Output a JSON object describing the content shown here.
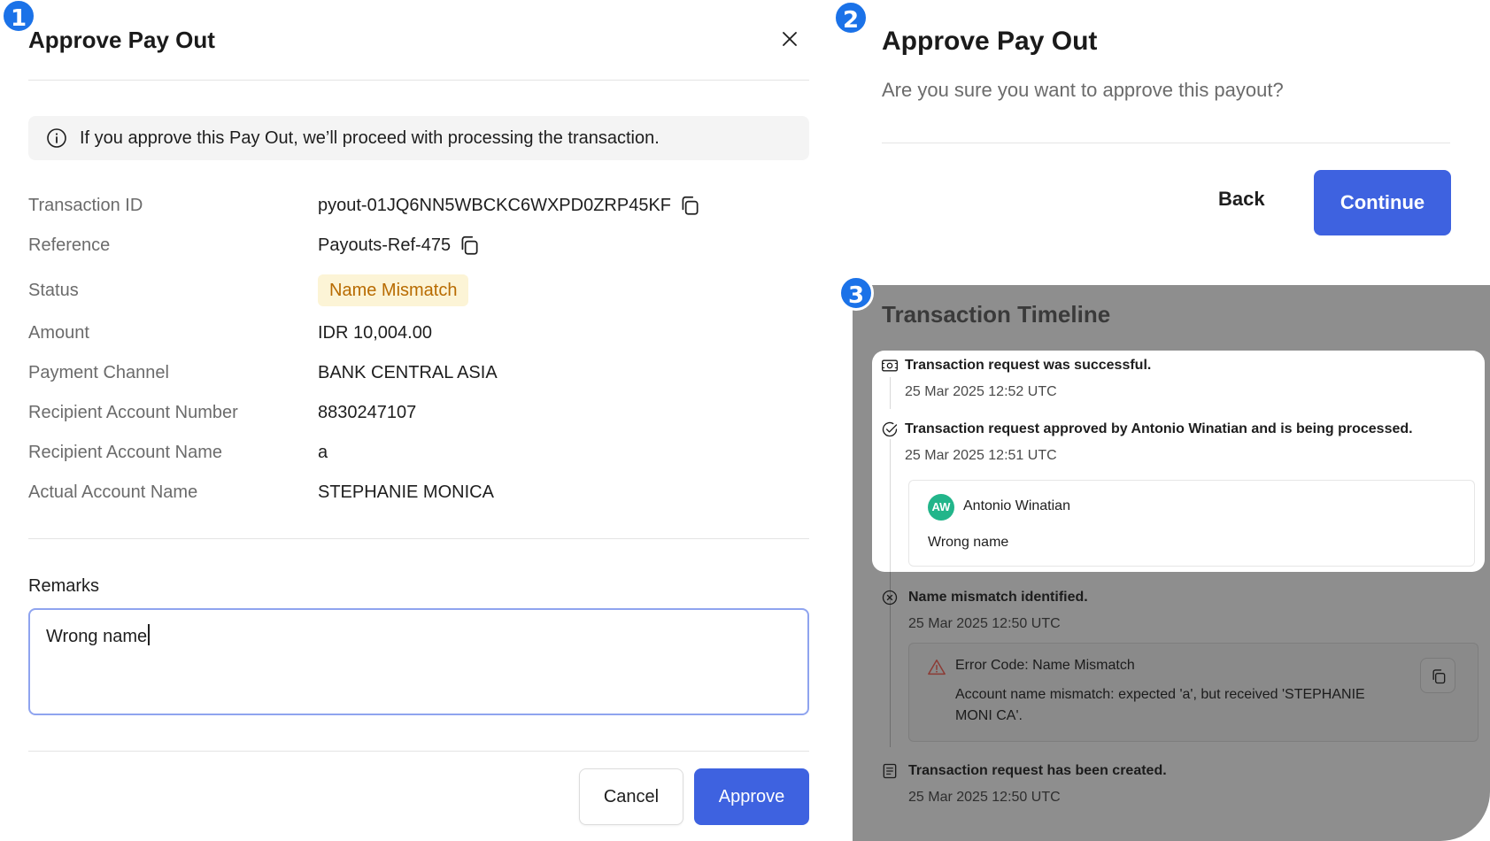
{
  "badges": [
    "1",
    "2",
    "3"
  ],
  "panel1": {
    "title": "Approve Pay Out",
    "info_text": "If you approve this Pay Out, we’ll proceed with processing the transaction.",
    "details": {
      "transaction_id": {
        "label": "Transaction ID",
        "value": "pyout-01JQ6NN5WBCKC6WXPD0ZRP45KF"
      },
      "reference": {
        "label": "Reference",
        "value": "Payouts-Ref-475"
      },
      "status": {
        "label": "Status",
        "value": "Name Mismatch"
      },
      "amount": {
        "label": "Amount",
        "value": "IDR 10,004.00"
      },
      "payment_channel": {
        "label": "Payment Channel",
        "value": "BANK CENTRAL ASIA"
      },
      "recipient_account_number": {
        "label": "Recipient Account Number",
        "value": "8830247107"
      },
      "recipient_account_name": {
        "label": "Recipient Account Name",
        "value": "a"
      },
      "actual_account_name": {
        "label": "Actual Account Name",
        "value": "STEPHANIE MONICA"
      }
    },
    "remarks_label": "Remarks",
    "remarks_value": "Wrong name",
    "cancel_label": "Cancel",
    "approve_label": "Approve"
  },
  "panel2": {
    "title": "Approve Pay Out",
    "subtitle": "Are you sure you want to approve this payout?",
    "back_label": "Back",
    "continue_label": "Continue"
  },
  "panel3": {
    "title": "Transaction Timeline",
    "events": [
      {
        "title": "Transaction request was successful.",
        "time": "25 Mar 2025 12:52 UTC",
        "icon": "money-icon"
      },
      {
        "title": "Transaction request approved by Antonio Winatian and is being processed.",
        "time": "25 Mar 2025 12:51 UTC",
        "icon": "check-circle-icon"
      },
      {
        "title": "Name mismatch identified.",
        "time": "25 Mar 2025 12:50 UTC",
        "icon": "x-circle-icon"
      },
      {
        "title": "Transaction request has been created.",
        "time": "25 Mar 2025 12:50 UTC",
        "icon": "document-icon"
      }
    ],
    "comment": {
      "initials": "AW",
      "user": "Antonio Winatian",
      "text": "Wrong name"
    },
    "error": {
      "title": "Error Code: Name Mismatch",
      "text": "Account name mismatch: expected 'a', but received 'STEPHANIE MONI CA'."
    }
  },
  "colors": {
    "badge": "#1b72e8",
    "primary_button": "#3e62e0",
    "status_pill_bg": "#fcf4d6",
    "status_pill_text": "#b86b00",
    "avatar": "#22b58a",
    "overlay": "#8e8e8e"
  }
}
